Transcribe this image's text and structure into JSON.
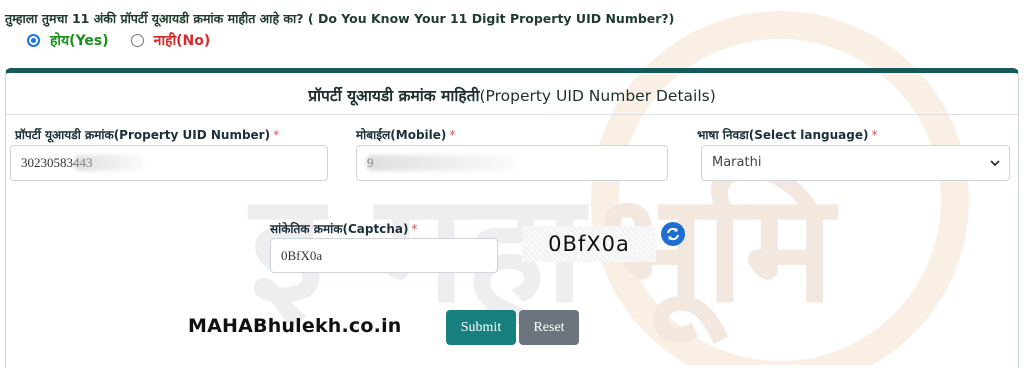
{
  "question": {
    "text": "तुम्हाला तुमचा 11 अंकी प्रॉपर्टी यूआयडी क्रमांक माहीत आहे का? ( Do You Know Your 11 Digit Property UID Number?)",
    "options": [
      {
        "label": "होय(Yes)",
        "selected": true
      },
      {
        "label": "नाही(No)",
        "selected": false
      }
    ]
  },
  "panel": {
    "title_mr": "प्रॉपर्टी यूआयडी क्रमांक माहिती",
    "title_en": "(Property UID Number Details)"
  },
  "form": {
    "uid": {
      "label": "प्रॉपर्टी यूआयडी क्रमांक(Property UID Number)",
      "required_mark": "*",
      "value": "30230583443"
    },
    "mobile": {
      "label": "मोबाईल(Mobile)",
      "required_mark": "*",
      "value": "9"
    },
    "language": {
      "label": "भाषा निवडा(Select language)",
      "required_mark": "*",
      "value": "Marathi"
    },
    "captcha": {
      "label": "सांकेतिक क्रमांक(Captcha)",
      "required_mark": "*",
      "value": "0BfX0a",
      "image_text": "0BfX0a"
    }
  },
  "brand_text": "MAHABhulekh.co.in",
  "buttons": {
    "submit": "Submit",
    "reset": "Reset"
  },
  "colors": {
    "accent_teal": "#17807e",
    "panel_border": "#17585a",
    "reset_gray": "#6c757d",
    "yes_green": "#1a8f1a",
    "no_red": "#d42a2a"
  }
}
